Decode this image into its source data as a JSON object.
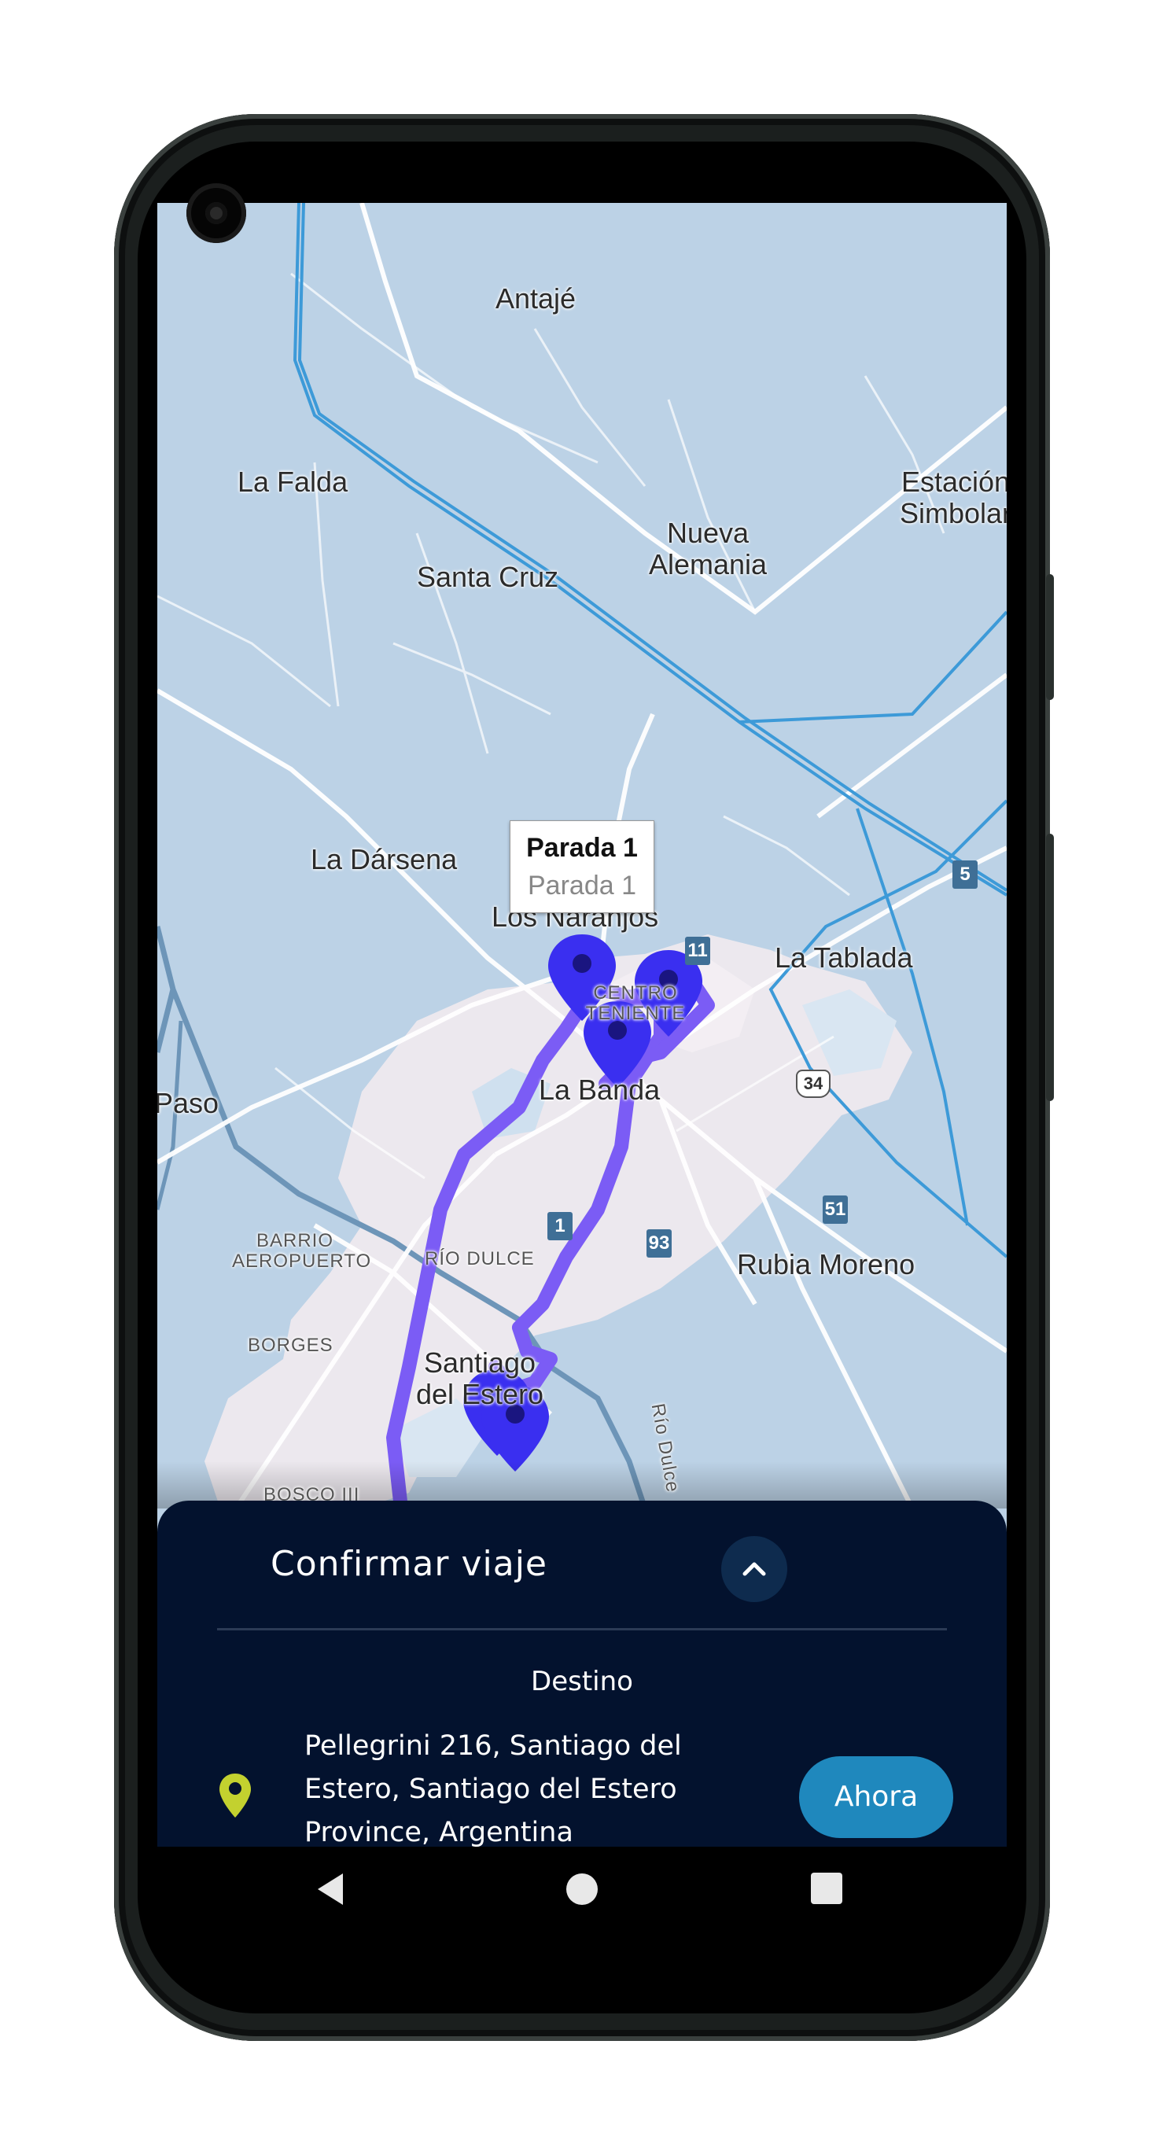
{
  "map": {
    "places": [
      "Antajé",
      "La Falda",
      "Estación Simbolar",
      "Nueva Alemania",
      "Santa Cruz",
      "La Dársena",
      "Los Naranjos",
      "La Tablada",
      "La Banda",
      "Paso",
      "Rubia Moreno",
      "Santiago del Estero"
    ],
    "districts": [
      "CENTRO TENIENTE",
      "BARRIO AEROPUERTO",
      "RÍO DULCE",
      "BORGES",
      "BOSCO III",
      "Río Dulce"
    ],
    "route_shields": [
      "11",
      "5",
      "34",
      "1",
      "93",
      "51"
    ],
    "route_color": "#7b5cf5",
    "marker_color": "#3a2ff0"
  },
  "tooltip": {
    "title": "Parada 1",
    "subtitle": "Parada 1"
  },
  "sheet": {
    "title": "Confirmar viaje",
    "collapse_icon": "chevron-up-icon",
    "destination_heading": "Destino",
    "address_line1": "Pellegrini 216, Santiago del",
    "address_line2": "Estero, Santiago del Estero",
    "address_line3": "Province, Argentina",
    "now_button": "Ahora",
    "pin_color": "#c3d12f",
    "background": "#03122e"
  },
  "nav": {
    "back_icon": "back-triangle-icon",
    "home_icon": "home-circle-icon",
    "recent_icon": "recent-square-icon"
  }
}
